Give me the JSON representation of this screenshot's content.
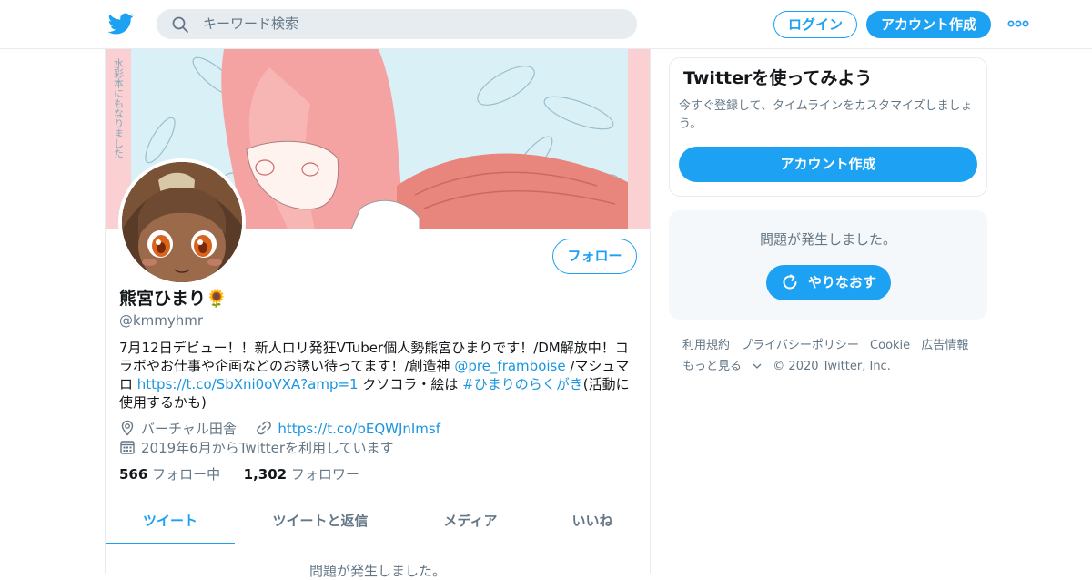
{
  "header": {
    "search_placeholder": "キーワード検索",
    "login_label": "ログイン",
    "signup_label": "アカウント作成",
    "brand_color": "#1da1f2"
  },
  "profile": {
    "name": "熊宮ひまり🌻",
    "handle": "@kmmyhmr",
    "follow_label": "フォロー",
    "bio": {
      "part1": "7月12日デビュー！！新人ロリ発狂VTuber個人勢熊宮ひまりです！/DM解放中！コラボやお仕事や企画などのお誘い待ってます！/創造神 ",
      "mention": "@pre_framboise",
      "part2": " /マシュマロ ",
      "url": "https://t.co/SbXni0oVXA?amp=1",
      "part3": " クソコラ・絵は ",
      "hashtag": "#ひまりのらくがき",
      "part4": "(活動に使用するかも)"
    },
    "location": "バーチャル田舎",
    "website": "https://t.co/bEQWJnImsf",
    "joined": "2019年6月からTwitterを利用しています",
    "following_count": "566",
    "following_label": "フォロー中",
    "followers_count": "1,302",
    "followers_label": "フォロワー",
    "banner_text": "水彩本にもなりました"
  },
  "tabs": [
    {
      "label": "ツイート"
    },
    {
      "label": "ツイートと返信"
    },
    {
      "label": "メディア"
    },
    {
      "label": "いいね"
    }
  ],
  "timeline": {
    "error_text": "問題が発生しました。"
  },
  "sidebar": {
    "card_title": "Twitterを使ってみよう",
    "card_text": "今すぐ登録して、タイムラインをカスタマイズしましょう。",
    "card_button": "アカウント作成",
    "error_text": "問題が発生しました。",
    "retry_label": "やりなおす"
  },
  "footer": {
    "links": [
      "利用規約",
      "プライバシーポリシー",
      "Cookie",
      "広告情報",
      "もっと見る"
    ],
    "copyright": "© 2020 Twitter, Inc."
  }
}
